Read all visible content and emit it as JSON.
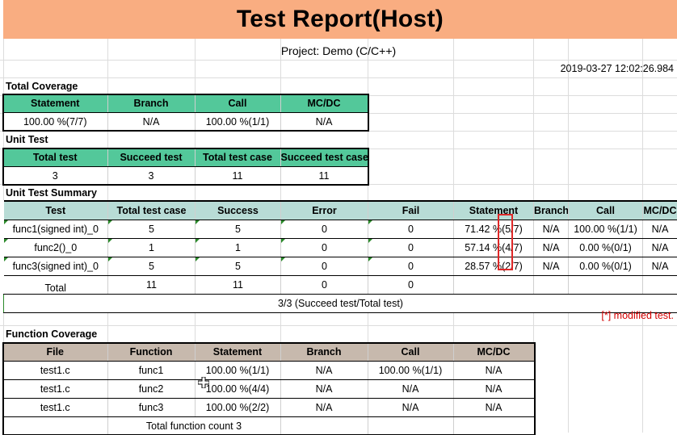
{
  "title": "Test Report(Host)",
  "project": "Project: Demo (C/C++)",
  "timestamp": "2019-03-27 12:02:26.984",
  "total_coverage": {
    "section": "Total Coverage",
    "headers": [
      "Statement",
      "Branch",
      "Call",
      "MC/DC"
    ],
    "values": [
      "100.00 %(7/7)",
      "N/A",
      "100.00 %(1/1)",
      "N/A"
    ]
  },
  "unit_test": {
    "section": "Unit Test",
    "headers": [
      "Total test",
      "Succeed test",
      "Total test case",
      "Succeed test case"
    ],
    "values": [
      "3",
      "3",
      "11",
      "11"
    ]
  },
  "summary": {
    "section": "Unit Test Summary",
    "headers": [
      "Test",
      "Total test case",
      "Success",
      "Error",
      "Fail",
      "Statement",
      "Branch",
      "Call",
      "MC/DC"
    ],
    "rows": [
      [
        "func1(signed int)_0",
        "5",
        "5",
        "0",
        "0",
        "71.42 %(5/7)",
        "N/A",
        "100.00 %(1/1)",
        "N/A"
      ],
      [
        "func2()_0",
        "1",
        "1",
        "0",
        "0",
        "57.14 %(4/7)",
        "N/A",
        "0.00 %(0/1)",
        "N/A"
      ],
      [
        "func3(signed int)_0",
        "5",
        "5",
        "0",
        "0",
        "28.57 %(2/7)",
        "N/A",
        "0.00 %(0/1)",
        "N/A"
      ]
    ],
    "total_row": [
      "Total",
      "11",
      "11",
      "0",
      "0"
    ],
    "ratio": "3/3 (Succeed test/Total test)",
    "modified_note": "[*] modified test."
  },
  "function_coverage": {
    "section": "Function Coverage",
    "headers": [
      "File",
      "Function",
      "Statement",
      "Branch",
      "Call",
      "MC/DC"
    ],
    "rows": [
      [
        "test1.c",
        "func1",
        "100.00 %(1/1)",
        "N/A",
        "100.00 %(1/1)",
        "N/A"
      ],
      [
        "test1.c",
        "func2",
        "100.00 %(4/4)",
        "N/A",
        "N/A",
        "N/A"
      ],
      [
        "test1.c",
        "func3",
        "100.00 %(2/2)",
        "N/A",
        "N/A",
        "N/A"
      ]
    ],
    "count": "Total function count 3"
  },
  "colors": {
    "title_band": "#f9ad81",
    "green_header": "#53c89a",
    "blue_header": "#b8dcd6",
    "taupe_header": "#c7b9ad",
    "highlight": "#e02828",
    "note": "#d40000"
  },
  "icons": [
    "cursor-move-icon"
  ]
}
